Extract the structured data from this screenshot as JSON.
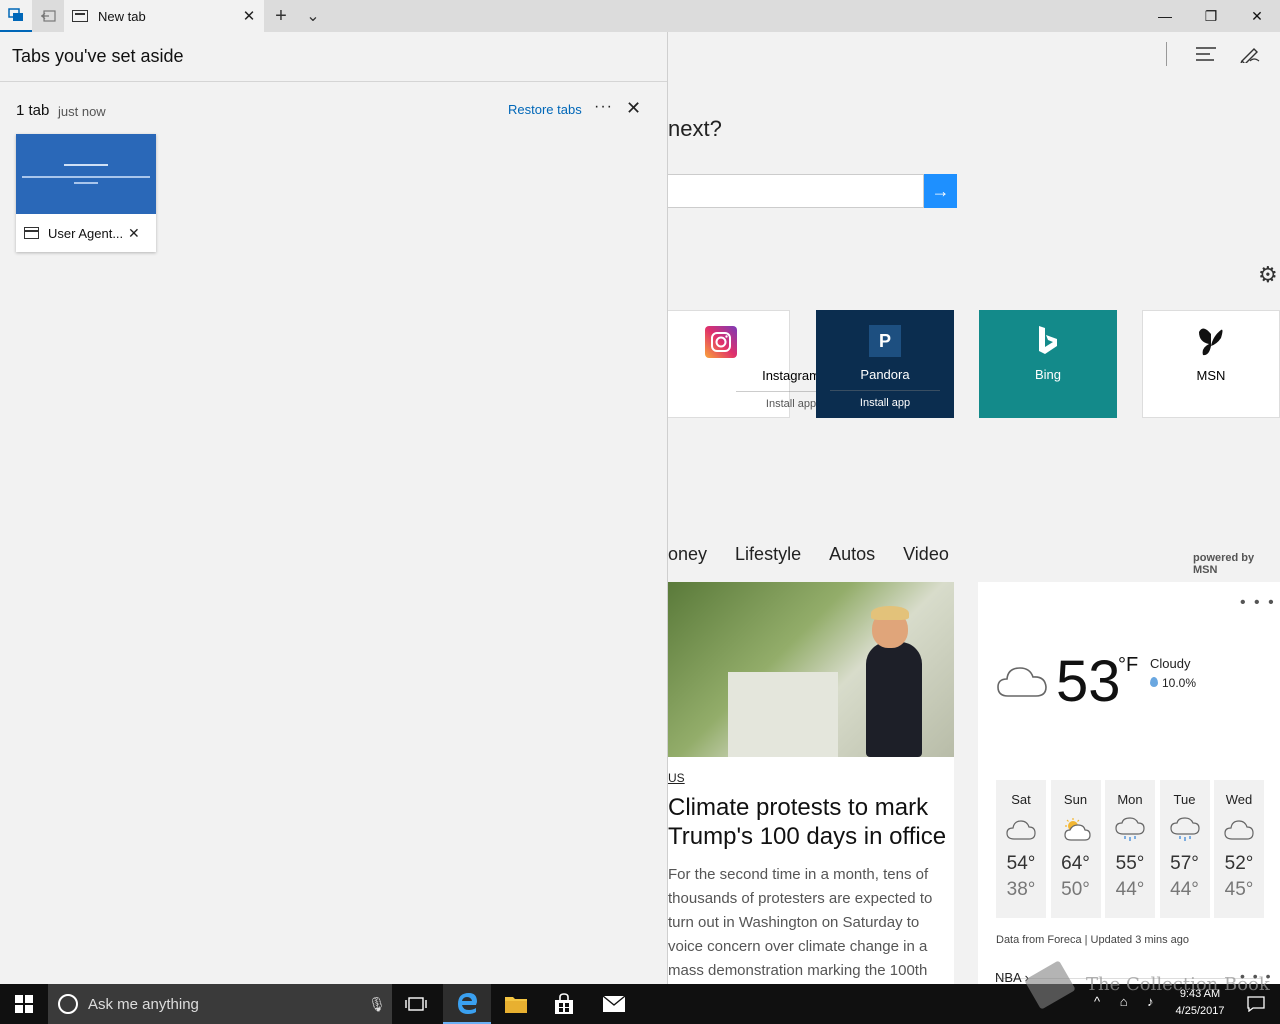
{
  "browser": {
    "tab_title": "New tab",
    "new_tab_glyph": "+",
    "tab_list_glyph": "⌄"
  },
  "window": {
    "minimize_glyph": "—",
    "maximize_glyph": "❐",
    "close_glyph": "✕"
  },
  "toolbar": {
    "icons": [
      "hub-icon",
      "web-note-icon",
      "share-icon",
      "more-icon"
    ]
  },
  "newtab": {
    "headline": "next?",
    "search_go_glyph": "→",
    "tiles": [
      {
        "name": "Instagram",
        "sub": "Install app"
      },
      {
        "name": "Pandora",
        "sub": "Install app",
        "glyph": "P"
      },
      {
        "name": "Bing",
        "sub": ""
      },
      {
        "name": "MSN",
        "sub": ""
      }
    ],
    "nav": [
      "oney",
      "Lifestyle",
      "Autos",
      "Video"
    ],
    "powered_by": "powered by MSN"
  },
  "story": {
    "category": "US",
    "title": "Climate protests to mark Trump's 100 days in office",
    "text": "For the second time in a month, tens of thousands of protesters are expected to turn out in Washington on Saturday to voice concern over climate change in a mass demonstration marking the 100th"
  },
  "weather": {
    "temp": "53",
    "unit": "°F",
    "condition": "Cloudy",
    "precip": "10.0%",
    "forecast": [
      {
        "day": "Sat",
        "hi": "54°",
        "lo": "38°",
        "icon": "cloud-icon"
      },
      {
        "day": "Sun",
        "hi": "64°",
        "lo": "50°",
        "icon": "partly-sunny-icon"
      },
      {
        "day": "Mon",
        "hi": "55°",
        "lo": "44°",
        "icon": "rain-icon"
      },
      {
        "day": "Tue",
        "hi": "57°",
        "lo": "44°",
        "icon": "rain-icon"
      },
      {
        "day": "Wed",
        "hi": "52°",
        "lo": "45°",
        "icon": "cloud-icon"
      }
    ],
    "source": "Data from Foreca | Updated 3 mins ago",
    "more": "• • •"
  },
  "nba": {
    "label": "NBA ›",
    "more": "• • •"
  },
  "aside": {
    "header": "Tabs you've set aside",
    "count": "1 tab",
    "time": "just now",
    "restore": "Restore tabs",
    "more": "···",
    "close": "✕",
    "saved_tab_title": "User Agent...",
    "saved_tab_close": "✕"
  },
  "taskbar": {
    "search_placeholder": "Ask me anything",
    "time": "9:43 AM",
    "date": "4/25/2017",
    "watermark": "The Collection Book"
  },
  "colors": {
    "accent": "#0067b8",
    "pandora_tile": "#0b2d4f",
    "bing_tile": "#138a8a",
    "search_go": "#1e90ff"
  }
}
